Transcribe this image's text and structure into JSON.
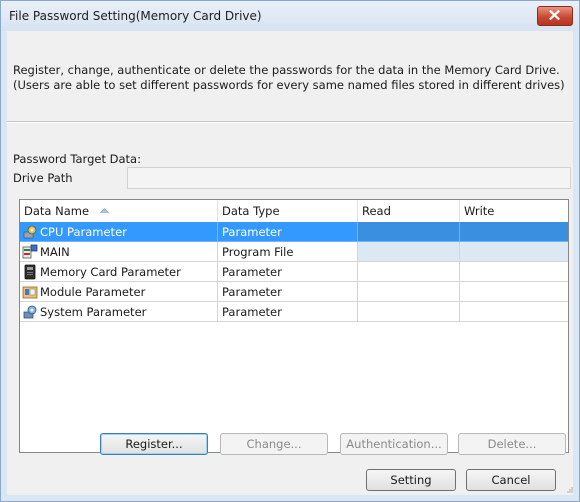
{
  "window": {
    "title": "File Password Setting(Memory Card Drive)",
    "close_icon": "close-x-icon"
  },
  "description": {
    "line1": "Register, change, authenticate or delete the passwords for the data in the Memory Card Drive.",
    "line2": "(Users are able to set different passwords for every same named files stored in different drives)"
  },
  "target": {
    "label": "Password Target Data:",
    "drive_path_label": "Drive Path",
    "drive_path_value": ""
  },
  "grid": {
    "columns": [
      "Data Name",
      "Data Type",
      "Read",
      "Write"
    ],
    "sort_column": "Data Name",
    "sort_direction": "ascending",
    "rows": [
      {
        "icon": "cpu-parameter-icon",
        "name": "CPU Parameter",
        "type": "Parameter",
        "read": "",
        "write": "",
        "selected": true
      },
      {
        "icon": "program-file-icon",
        "name": "MAIN",
        "type": "Program File",
        "read": "",
        "write": "",
        "selected": false
      },
      {
        "icon": "memory-card-parameter-icon",
        "name": "Memory Card Parameter",
        "type": "Parameter",
        "read": "",
        "write": "",
        "selected": false
      },
      {
        "icon": "module-parameter-icon",
        "name": "Module Parameter",
        "type": "Parameter",
        "read": "",
        "write": "",
        "selected": false
      },
      {
        "icon": "system-parameter-icon",
        "name": "System Parameter",
        "type": "Parameter",
        "read": "",
        "write": "",
        "selected": false
      }
    ]
  },
  "buttons": {
    "register": "Register...",
    "change": "Change...",
    "authentication": "Authentication...",
    "delete": "Delete...",
    "setting": "Setting",
    "cancel": "Cancel"
  },
  "colors": {
    "selection": "#3399ff",
    "titlebar": "#dbe6f3",
    "close_button": "#c84a34"
  }
}
